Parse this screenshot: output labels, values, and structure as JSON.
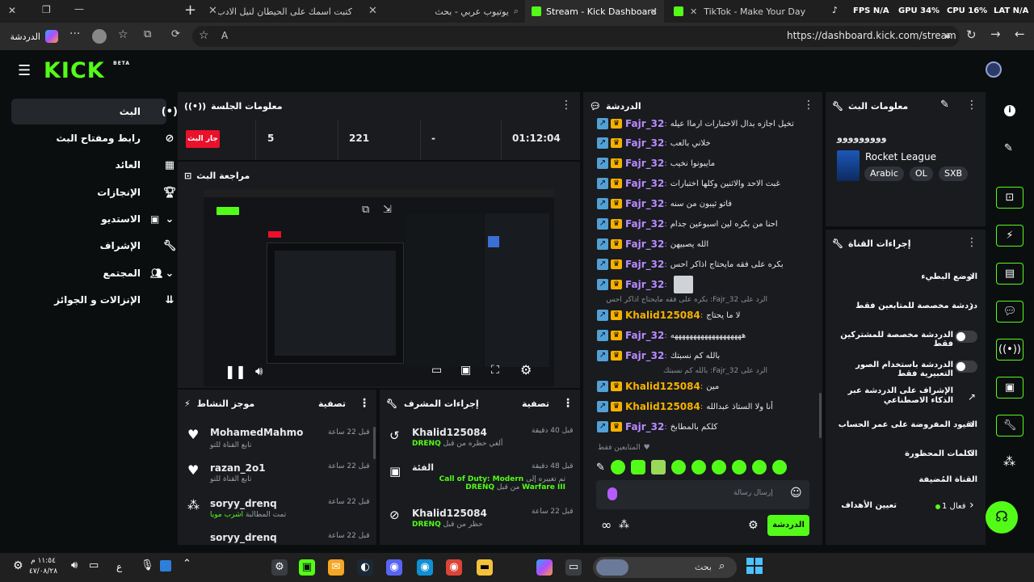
{
  "browser": {
    "tabs": [
      {
        "label": "كتبت اسمك على الحيطان لنيل الادب..."
      },
      {
        "label": "يوتيوب عربي - بحث"
      },
      {
        "label": "Stream - Kick Dashboard"
      },
      {
        "label": "TikTok - Make Your Day"
      }
    ],
    "overlay_fps": "FPS N/A",
    "overlay_gpu": "GPU 34%",
    "overlay_cpu": "CPU 16%",
    "overlay_lat": "LAT N/A",
    "url": "https://dashboard.kick.com/stream",
    "chat_button": "الدردشة"
  },
  "brand": {
    "logo": "KICK",
    "beta": "BETA",
    "color": "#53fc18"
  },
  "sidebar": {
    "items": [
      {
        "label": "البث",
        "icon": "broadcast-icon",
        "active": true
      },
      {
        "label": "رابط ومفتاح البث",
        "icon": "link-icon"
      },
      {
        "label": "العائد",
        "icon": "revenue-icon"
      },
      {
        "label": "الإنجازات",
        "icon": "trophy-icon"
      },
      {
        "label": "الاستديو",
        "icon": "studio-icon",
        "expand": true
      },
      {
        "label": "الإشراف",
        "icon": "wrench-icon"
      },
      {
        "label": "المجتمع",
        "icon": "community-icon",
        "expand": true
      },
      {
        "label": "الإنزالات و الجوائز",
        "icon": "drops-icon"
      }
    ]
  },
  "session": {
    "title": "معلومات الجلسة",
    "live_badge": "جار البث",
    "stats": [
      "5",
      "221",
      "-",
      "01:12:04"
    ],
    "stat_captions": [
      "",
      "",
      "",
      ""
    ]
  },
  "preview": {
    "title": "مراجعة البث"
  },
  "activity": {
    "title": "موجز النشاط",
    "filter": "تصفية",
    "items": [
      {
        "name": "MohamedMahmo",
        "desc": "تابع القناة للتو",
        "time": "قبل 22 ساعة"
      },
      {
        "name": "razan_2o1",
        "desc": "تابع القناة للتو",
        "time": "قبل 22 ساعة"
      },
      {
        "name": "soryy_drenq",
        "desc": "تمت المطالبة",
        "desc_highlight": "اشرب مويا",
        "time": "قبل 22 ساعة"
      },
      {
        "name": "soryy_drenq",
        "desc": "",
        "time": "قبل 22 ساعة"
      }
    ]
  },
  "modactions": {
    "title": "إجراءات المشرف",
    "filter": "تصفية",
    "items": [
      {
        "name": "Khalid125084",
        "desc": "ألغي حظره من قبل",
        "by": "DRENQ",
        "time": "قبل 40 دقيقة"
      },
      {
        "name": "الفئة",
        "desc": "تم تغييره إلى",
        "target": "Call of Duty: Modern Warfare III",
        "by_prefix": "من قبل",
        "by": "DRENQ",
        "time": "قبل 48 دقيقة"
      },
      {
        "name": "Khalid125084",
        "desc": "حظر من قبل",
        "by": "DRENQ",
        "time": "قبل 22 ساعة"
      }
    ]
  },
  "chat": {
    "title": "الدردشة",
    "messages": [
      {
        "user": "Fajr_32",
        "text": "تخيل اجازه بدال الاختبارات ارماا عيله",
        "color": "#b98bff"
      },
      {
        "user": "Fajr_32",
        "text": "خلاني بالعب",
        "color": "#b98bff"
      },
      {
        "user": "Fajr_32",
        "text": "مايبونوا نخيب",
        "color": "#b98bff"
      },
      {
        "user": "Fajr_32",
        "text": "غبت الاحد والاثنين وكلها اختبارات",
        "color": "#b98bff"
      },
      {
        "user": "Fajr_32",
        "text": "فاتو ثيبون من سنه",
        "color": "#b98bff"
      },
      {
        "user": "Fajr_32",
        "text": "احنا من بكره لين اسبوعين جدام",
        "color": "#b98bff"
      },
      {
        "user": "Fajr_32",
        "text": "الله يصبيهن",
        "color": "#b98bff"
      },
      {
        "user": "Fajr_32",
        "text": "بكره على فقه مايحتاج اذاكر احس",
        "color": "#b98bff"
      },
      {
        "user": "Fajr_32",
        "text": "",
        "color": "#b98bff"
      },
      {
        "user": "Khalid125084",
        "text": "لا ما يحتاج",
        "color": "#f5b100",
        "reply": "الرد على Fajr_32: بكره على فقه مايحتاج اذاكر احس"
      },
      {
        "user": "Fajr_32",
        "text": "هههههههههههههههههههه",
        "color": "#b98bff"
      },
      {
        "user": "Fajr_32",
        "text": "بالله كم نسبتك",
        "color": "#b98bff"
      },
      {
        "user": "Khalid125084",
        "text": "مين",
        "color": "#f5b100",
        "reply": "الرد على Fajr_32: بالله كم نسبتك"
      },
      {
        "user": "Khalid125084",
        "text": "أنا ولا الستاذ عبدالله",
        "color": "#f5b100"
      },
      {
        "user": "Fajr_32",
        "text": "كلكم بالمطابخ",
        "color": "#b98bff"
      }
    ],
    "followers_only": "المتابعين فقط",
    "input_placeholder": "إرسال رسالة",
    "send_label": "الدردشة"
  },
  "streaminfo": {
    "title": "معلومات البث",
    "stream_title": "ووووووووو",
    "game": "Rocket League",
    "tags": [
      "Arabic",
      "OL",
      "SXB"
    ]
  },
  "channel_actions": {
    "title": "إجراءات القناة",
    "items": [
      {
        "label": "الوضع البطيء",
        "type": "chevron"
      },
      {
        "label": "دردشة مخصصة للمتابعين فقط",
        "type": "chevron"
      },
      {
        "label": "الدردشة مخصصة للمشتركين فقط",
        "type": "toggle"
      },
      {
        "label": "الدردشة باستخدام الصور التعبيرية فقط",
        "type": "toggle"
      },
      {
        "label": "الإشراف على الدردشة عبر الذكاء الاصطناعي",
        "type": "external"
      },
      {
        "label": "القيود المفروضة على عمر الحساب",
        "type": "chevron"
      },
      {
        "label": "الكلمات المحظورة",
        "type": "chevron"
      }
    ],
    "section2": "القناة المُضيفة",
    "goals_label": "تعيين الأهداف",
    "goals_status": "فعال 1"
  },
  "taskbar": {
    "time": "١١:٥٤ م",
    "date": "٤٧/٠٨/٢٨",
    "lang": "ع",
    "search": "بحث"
  }
}
